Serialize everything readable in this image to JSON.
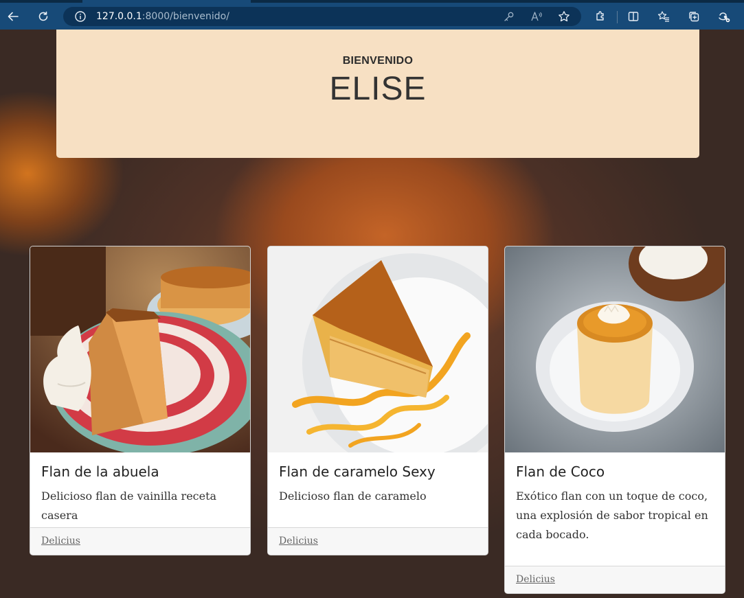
{
  "browser": {
    "url_host": "127.0.0.1",
    "url_path": ":8000/bienvenido/",
    "icons": [
      "back-icon",
      "refresh-icon",
      "info-icon",
      "key-icon",
      "read-aloud-icon",
      "favorite-star-icon",
      "extensions-icon",
      "split-screen-icon",
      "favorites-icon",
      "collections-icon",
      "copilot-icon"
    ]
  },
  "hero": {
    "subtitle": "BIENVENIDO",
    "name": "ELISE"
  },
  "cards": [
    {
      "title": "Flan de la abuela",
      "text": "Delicioso flan de vainilla receta casera",
      "link": "Delicius"
    },
    {
      "title": "Flan de caramelo Sexy",
      "text": "Delicioso flan de caramelo",
      "link": "Delicius"
    },
    {
      "title": "Flan de Coco",
      "text": "Exótico flan con un toque de coco, una explosión de sabor tropical en cada bocado.",
      "link": "Delicius"
    }
  ],
  "colors": {
    "chrome": "#174a78",
    "omnibox": "#0c3358",
    "hero_bg": "#f7e0c3",
    "card_footer": "#f7f7f7"
  }
}
